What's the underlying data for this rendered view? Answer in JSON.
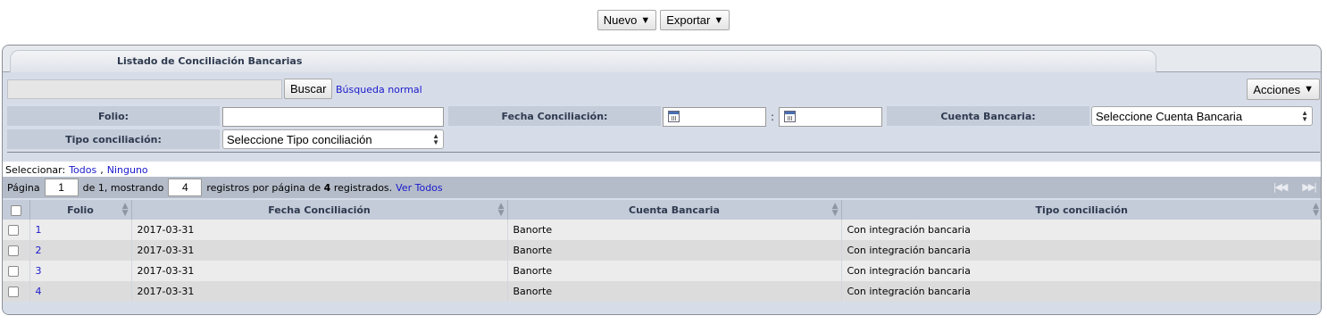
{
  "toolbar": {
    "nuevo_label": "Nuevo",
    "exportar_label": "Exportar"
  },
  "panel": {
    "title": "Listado de Conciliación Bancarias"
  },
  "search": {
    "value": "",
    "button_label": "Buscar",
    "normal_link": "Búsqueda normal",
    "acciones_label": "Acciones"
  },
  "filters": {
    "folio_label": "Folio:",
    "folio_value": "",
    "fecha_label": "Fecha Conciliación:",
    "fecha_separator": ":",
    "cuenta_label": "Cuenta Bancaria:",
    "cuenta_selected": "Seleccione Cuenta Bancaria",
    "tipo_label": "Tipo conciliación:",
    "tipo_selected": "Seleccione Tipo conciliación"
  },
  "selection": {
    "prefix": "Seleccionar:",
    "all": "Todos",
    "none": "Ninguno"
  },
  "pager": {
    "page_label": "Página",
    "page_value": "1",
    "of_text": "de 1, mostrando",
    "per_page_value": "4",
    "registered_prefix": "registros por página de",
    "total": "4",
    "registered_suffix": "registrados.",
    "ver_todos": "Ver Todos"
  },
  "table": {
    "columns": [
      "Folio",
      "Fecha Conciliación",
      "Cuenta Bancaria",
      "Tipo conciliación"
    ],
    "rows": [
      {
        "folio": "1",
        "fecha": "2017-03-31",
        "cuenta": "Banorte",
        "tipo": "Con integración bancaria"
      },
      {
        "folio": "2",
        "fecha": "2017-03-31",
        "cuenta": "Banorte",
        "tipo": "Con integración bancaria"
      },
      {
        "folio": "3",
        "fecha": "2017-03-31",
        "cuenta": "Banorte",
        "tipo": "Con integración bancaria"
      },
      {
        "folio": "4",
        "fecha": "2017-03-31",
        "cuenta": "Banorte",
        "tipo": "Con integración bancaria"
      }
    ]
  },
  "icons": {
    "caret": "caret-down-icon",
    "calendar": "calendar-icon",
    "first_page": "first-page-icon",
    "last_page": "last-page-icon"
  }
}
